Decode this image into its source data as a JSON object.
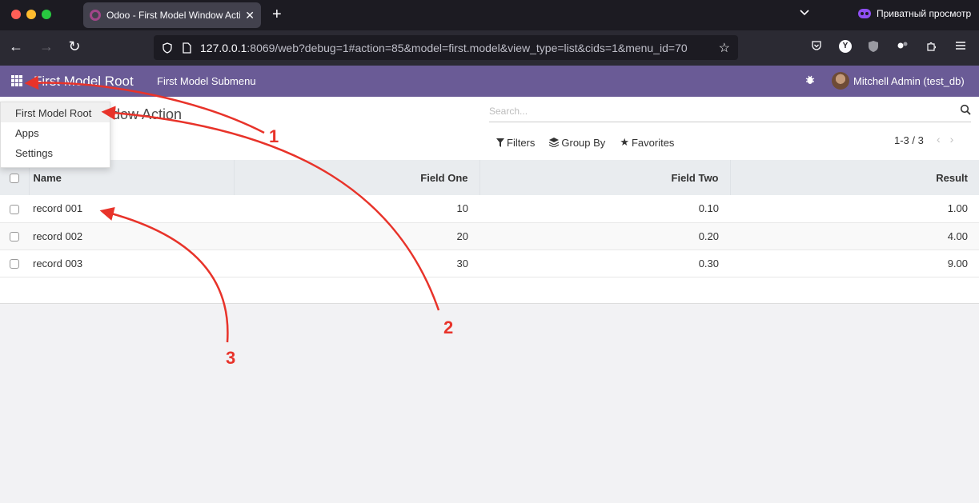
{
  "browser": {
    "tab_title": "Odoo - First Model Window Acti",
    "private_label": "Приватный просмотр",
    "url_host": "127.0.0.1",
    "url_rest": ":8069/web?debug=1#action=85&model=first.model&view_type=list&cids=1&menu_id=70"
  },
  "odoo_nav": {
    "brand": "First Model Root",
    "submenu": "First Model Submenu",
    "user": "Mitchell Admin (test_db)"
  },
  "control_panel": {
    "title": "dow Action",
    "search_placeholder": "Search...",
    "filters": "Filters",
    "group_by": "Group By",
    "favorites": "Favorites",
    "pager": "1-3 / 3"
  },
  "dropdown": {
    "items": [
      {
        "label": "First Model Root"
      },
      {
        "label": "Apps"
      },
      {
        "label": "Settings"
      }
    ]
  },
  "table": {
    "headers": [
      "Name",
      "Field One",
      "Field Two",
      "Result"
    ],
    "rows": [
      {
        "name": "record 001",
        "field_one": "10",
        "field_two": "0.10",
        "result": "1.00"
      },
      {
        "name": "record 002",
        "field_one": "20",
        "field_two": "0.20",
        "result": "4.00"
      },
      {
        "name": "record 003",
        "field_one": "30",
        "field_two": "0.30",
        "result": "9.00"
      }
    ]
  },
  "annotations": {
    "labels": [
      "1",
      "2",
      "3"
    ],
    "color": "#e8332a"
  },
  "colors": {
    "odoo_primary": "#6a5b96",
    "browser_dark": "#1c1b22"
  }
}
